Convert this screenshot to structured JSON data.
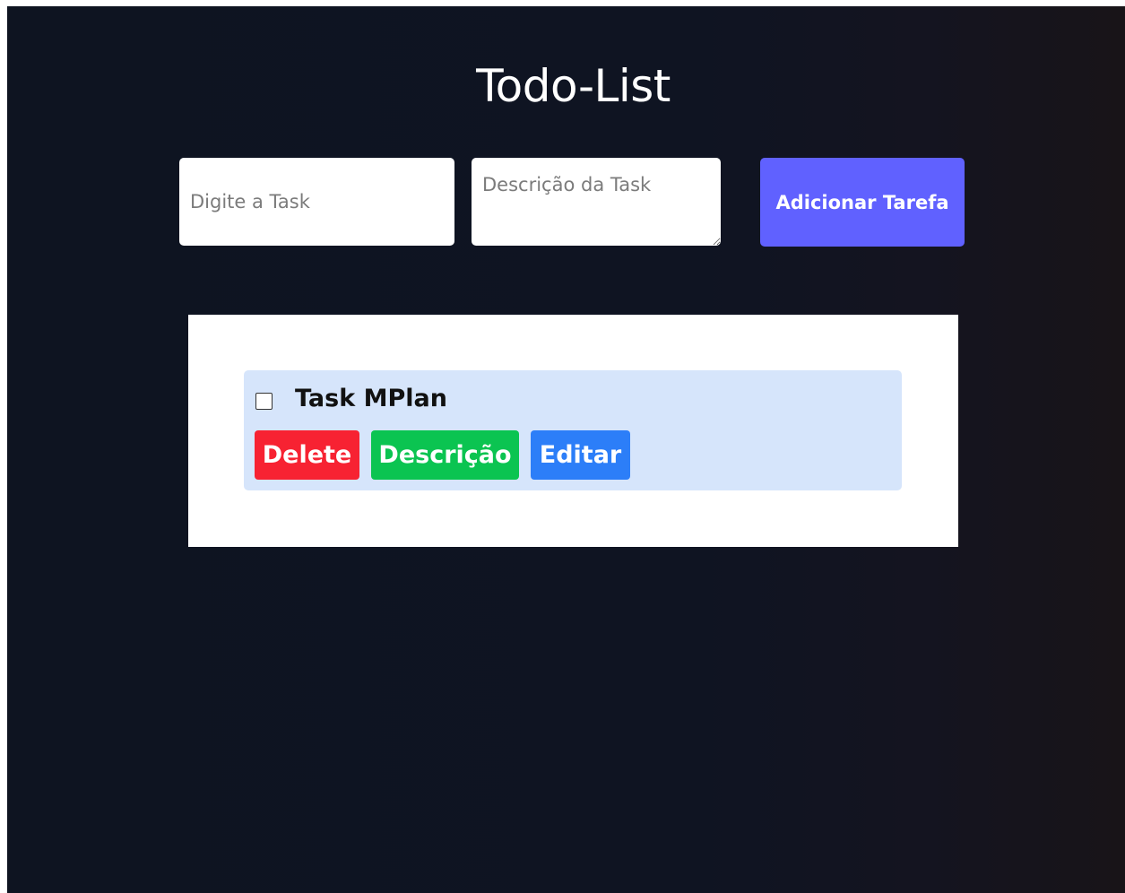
{
  "header": {
    "title": "Todo-List"
  },
  "form": {
    "task_placeholder": "Digite a Task",
    "task_value": "",
    "description_placeholder": "Descrição da Task",
    "description_value": "",
    "add_button_label": "Adicionar Tarefa"
  },
  "tasks": [
    {
      "title": "Task MPlan",
      "completed": false,
      "delete_label": "Delete",
      "description_label": "Descrição",
      "edit_label": "Editar"
    }
  ],
  "colors": {
    "background": "#0e1421",
    "add_button": "#6061ff",
    "delete_button": "#f72232",
    "description_button": "#0bc451",
    "edit_button": "#2c7ef8",
    "task_card": "#d6e5fb"
  }
}
